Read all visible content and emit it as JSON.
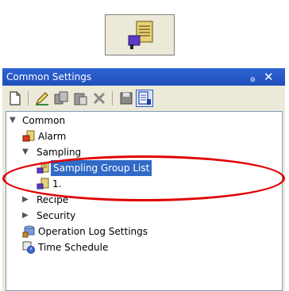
{
  "panel": {
    "title": "Common Settings",
    "pin_glyph": "๏",
    "close_glyph": "✕"
  },
  "toolbar": {
    "buttons": [
      "new-document-icon",
      "edit-pencil-icon",
      "copy-icon",
      "paste-icon",
      "delete-icon",
      "save-icon",
      "properties-icon"
    ]
  },
  "tree": {
    "common": "Common",
    "alarm": "Alarm",
    "sampling": "Sampling",
    "sampling_group_list": "Sampling Group List",
    "group_1": "1.",
    "recipe": "Recipe",
    "security": "Security",
    "operation_log": "Operation Log Settings",
    "time_schedule": "Time Schedule"
  },
  "colors": {
    "title_bar": "#2f63d4",
    "selection": "#3169c6",
    "highlight": "#e00000"
  }
}
